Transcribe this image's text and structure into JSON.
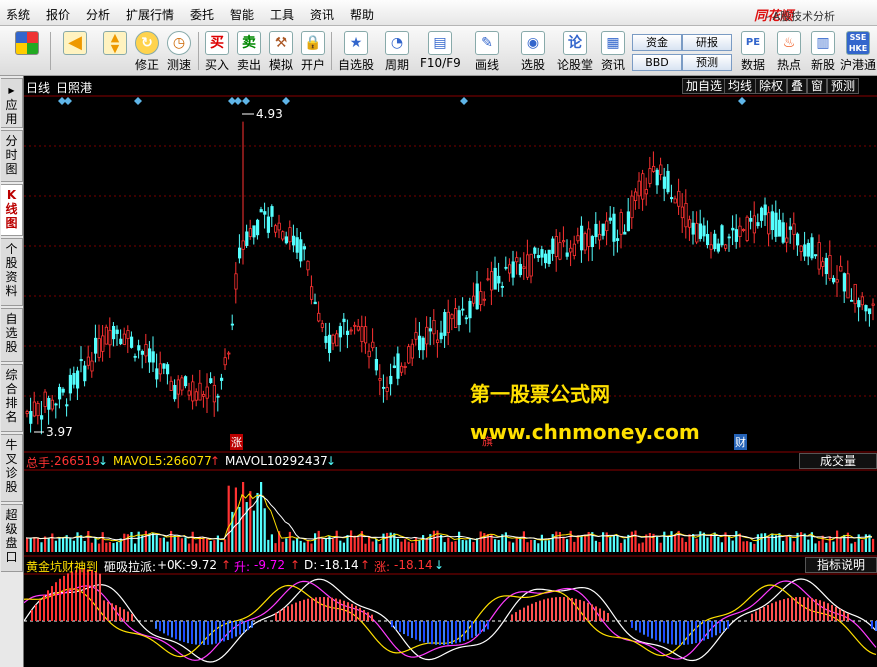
{
  "menu": [
    "系统",
    "报价",
    "分析",
    "扩展行情",
    "委托",
    "智能",
    "工具",
    "资讯",
    "帮助"
  ],
  "brand": {
    "name": "同花顺",
    "subtitle": "- A股技术分析"
  },
  "toolbar": [
    {
      "label": "",
      "icon": "windows-icon"
    },
    {
      "label": "",
      "icon": "back-arrow-icon"
    },
    {
      "label": "",
      "icon": "up-down-arrows-icon"
    },
    {
      "label": "修正",
      "icon": "revise-icon"
    },
    {
      "label": "测速",
      "icon": "clock-icon"
    },
    {
      "label": "买入",
      "icon": "buy-icon",
      "glyph": "买"
    },
    {
      "label": "卖出",
      "icon": "sell-icon",
      "glyph": "卖"
    },
    {
      "label": "模拟",
      "icon": "hammer-icon"
    },
    {
      "label": "开户",
      "icon": "lock-icon"
    },
    {
      "label": "自选股",
      "icon": "star-icon"
    },
    {
      "label": "周期",
      "icon": "period-icon"
    },
    {
      "label": "F10/F9",
      "icon": "f10-icon"
    },
    {
      "label": "画线",
      "icon": "pencil-icon"
    },
    {
      "label": "选股",
      "icon": "select-stock-icon"
    },
    {
      "label": "论股堂",
      "icon": "forum-icon",
      "glyph": "论"
    },
    {
      "label": "资讯",
      "icon": "news-icon"
    },
    {
      "label": "数据",
      "icon": "pe-data-icon",
      "glyph": "PE"
    },
    {
      "label": "热点",
      "icon": "hot-icon"
    },
    {
      "label": "新股",
      "icon": "new-stock-icon"
    },
    {
      "label": "沪港通",
      "icon": "sse-hke-icon"
    }
  ],
  "small_buttons": {
    "fund": "资金",
    "research": "研报",
    "bbd": "BBD",
    "forecast": "预测"
  },
  "sidebar": [
    "应用",
    "分时图",
    "K线图",
    "个股资料",
    "自选股",
    "综合排名",
    "牛叉诊股",
    "超级盘口"
  ],
  "chart_header": {
    "period": "日线",
    "stock": "日照港"
  },
  "chart_buttons": [
    "加自选",
    "均线",
    "除权",
    "叠",
    "窗",
    "预测"
  ],
  "price_labels": {
    "high": "4.93",
    "low": "3.97"
  },
  "markers": {
    "zhang": "涨",
    "cai": "财",
    "flag": "旗"
  },
  "volume": {
    "total_label": "总手:",
    "total": "266519",
    "arrow_total": "↓",
    "mavol5_label": "MAVOL5:",
    "mavol5": "266077",
    "arrow_5": "↑",
    "mavol10_label": "MAVOL10:",
    "mavol10": "292437",
    "arrow_10": "↓",
    "panel_name": "成交量"
  },
  "indicator": {
    "name": "黄金坑财神到",
    "xi": "砸吸拉派:",
    "xi_val": "+0",
    "k_label": "K:",
    "k_val": "-9.72",
    "k_arrow": "↑",
    "sheng_label": "升:",
    "sheng_val": "-9.72",
    "sheng_arrow": "↑",
    "d_label": "D:",
    "d_val": "-18.14",
    "d_arrow": "↑",
    "zhang_label": "涨:",
    "zhang_val": "-18.14",
    "zhang_arrow": "↓",
    "help": "指标说明"
  },
  "watermark": {
    "line1": "第一股票公式网",
    "line2": "www.chnmoney.com"
  },
  "colors": {
    "up": "#ff3232",
    "down": "#54ffff",
    "background": "#000000",
    "grid": "#7a0000",
    "accent": "#ffe000"
  }
}
